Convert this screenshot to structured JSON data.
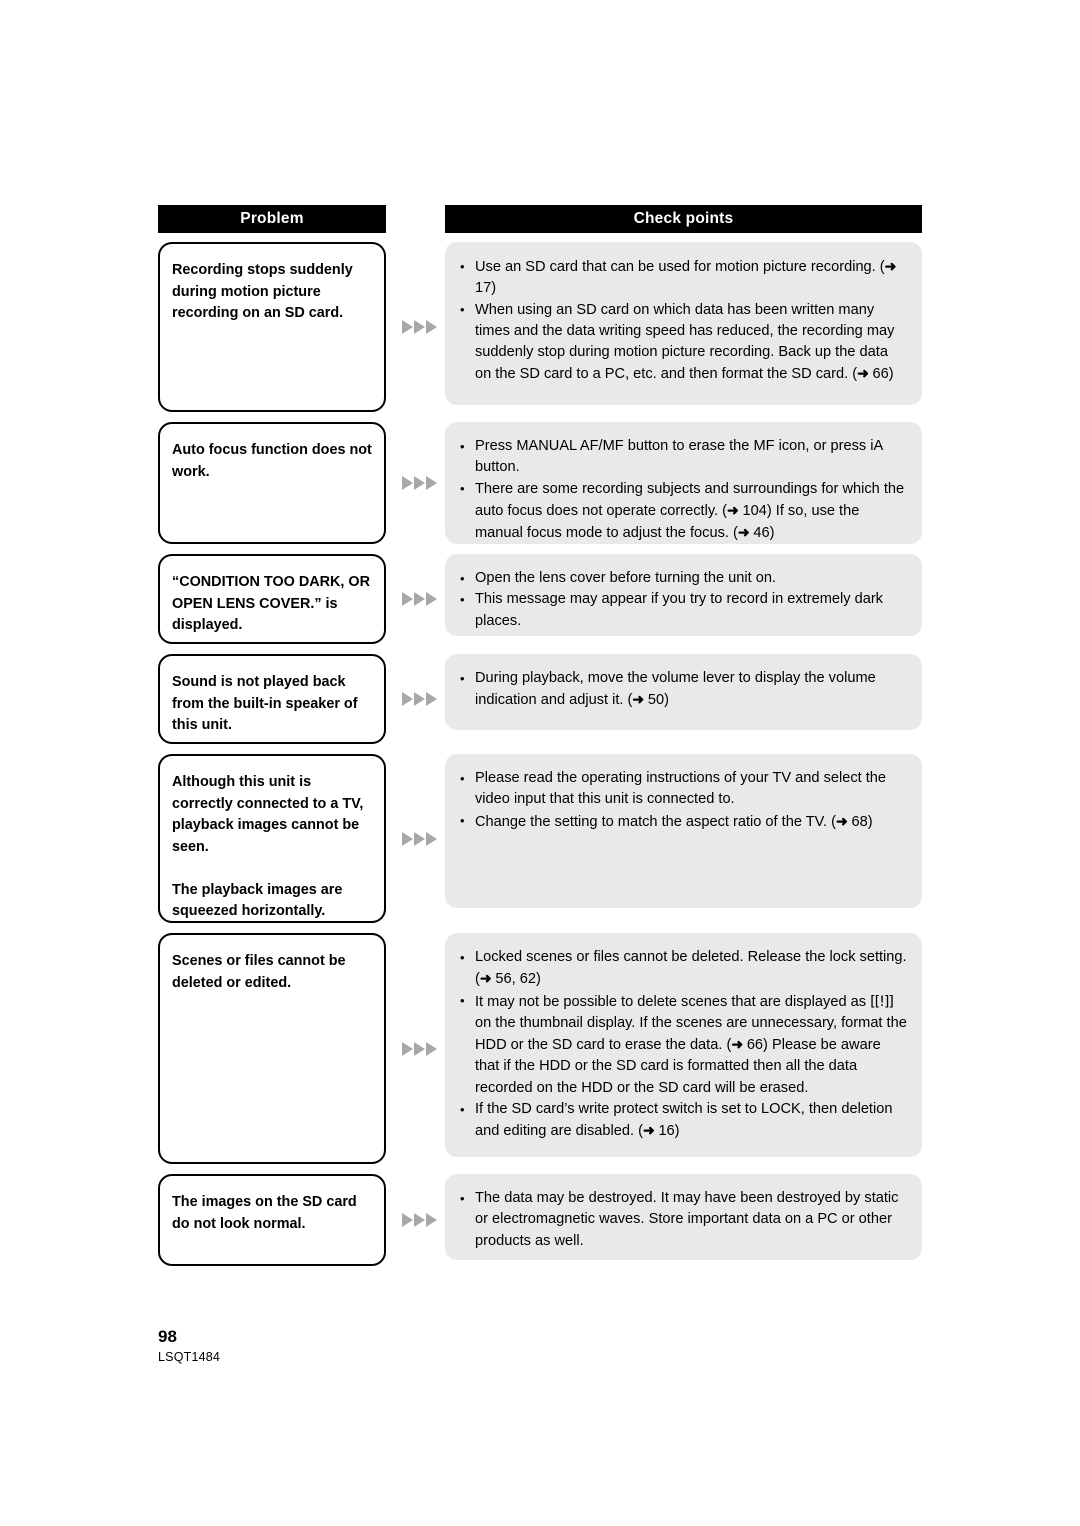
{
  "document": {
    "page_number": "98",
    "document_code": "LSQT1484"
  },
  "table": {
    "headers": {
      "problem": "Problem",
      "check_points": "Check points"
    },
    "separator_icon": "triple-right-triangle",
    "rows": [
      {
        "problem_paragraphs": [
          "Recording stops suddenly during motion picture recording on an SD card."
        ],
        "check_points": [
          "Use an SD card that can be used for motion picture recording. (➜ 17)",
          "When using an SD card on which data has been written many times and the data writing speed has reduced, the recording may suddenly stop during motion picture recording. Back up the data on the SD card to a PC, etc. and then format the SD card. (➜ 66)"
        ]
      },
      {
        "problem_paragraphs": [
          "Auto focus function does not work."
        ],
        "check_points": [
          "Press MANUAL AF/MF button to erase the MF icon, or press iA button.",
          "There are some recording subjects and surroundings for which the auto focus does not operate correctly. (➜ 104) If so, use the manual focus mode to adjust the focus. (➜ 46)"
        ]
      },
      {
        "problem_paragraphs": [
          "“CONDITION TOO DARK, OR OPEN LENS COVER.” is displayed."
        ],
        "check_points": [
          "Open the lens cover before turning the unit on.",
          "This message may appear if you try to record in extremely dark places."
        ]
      },
      {
        "problem_paragraphs": [
          "Sound is not played back from the built-in speaker of this unit."
        ],
        "check_points": [
          "During playback, move the volume lever to display the volume indication and adjust it. (➜ 50)"
        ]
      },
      {
        "problem_paragraphs": [
          "Although this unit is correctly connected to a TV, playback images cannot be seen.",
          "The playback images are squeezed horizontally."
        ],
        "check_points": [
          "Please read the operating instructions of your TV and select the video input that this unit is connected to.",
          "Change the setting to match the aspect ratio of the TV. (➜ 68)"
        ]
      },
      {
        "problem_paragraphs": [
          "Scenes or files cannot be deleted or edited."
        ],
        "check_points": [
          "Locked scenes or files cannot be deleted. Release the lock setting. (➜ 56, 62)",
          "It may not be possible to delete scenes that are displayed as [[!]] on the thumbnail display. If the scenes are unnecessary, format the HDD or the SD card to erase the data. (➜ 66) Please be aware that if the HDD or the SD card is formatted then all the data recorded on the HDD or the SD card will be erased.",
          "If the SD card’s write protect switch is set to LOCK, then deletion and editing are disabled. (➜ 16)"
        ]
      },
      {
        "problem_paragraphs": [
          "The images on the SD card do not look normal."
        ],
        "check_points": [
          "The data may be destroyed. It may have been destroyed by static or electromagnetic waves. Store important data on a PC or other products as well."
        ]
      }
    ],
    "row_heights": [
      {
        "problem": 170,
        "check": 163
      },
      {
        "problem": 122,
        "check": 122
      },
      {
        "problem": 90,
        "check": 82
      },
      {
        "problem": 90,
        "check": 76
      },
      {
        "problem": 169,
        "check": 154
      },
      {
        "problem": 231,
        "check": 224
      },
      {
        "problem": 92,
        "check": 86
      }
    ]
  },
  "colors": {
    "header_background": "#000000",
    "header_text": "#ffffff",
    "problem_border": "#000000",
    "check_background": "#e9e9e9",
    "arrow": "#a8a8a8",
    "page_background": "#ffffff"
  }
}
